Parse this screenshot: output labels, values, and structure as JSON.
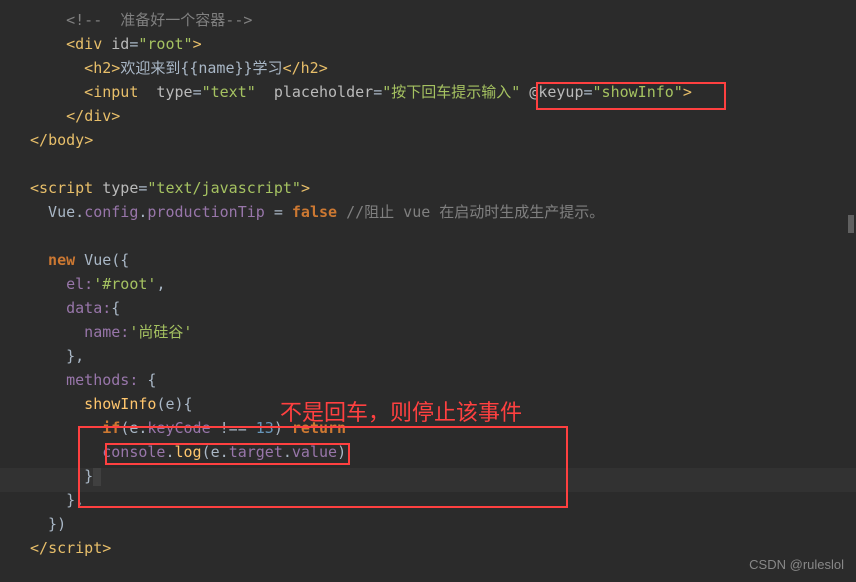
{
  "code": {
    "l1": "    <!--  准备好一个容器-->",
    "l2_p1": "    <",
    "l2_tag": "div",
    "l2_attr": " id",
    "l2_eq": "=",
    "l2_val": "\"root\"",
    "l2_close": ">",
    "l3_p1": "      <",
    "l3_tag": "h2",
    "l3_close1": ">",
    "l3_text": "欢迎来到{{name}}学习",
    "l3_closetag": "</",
    "l3_tag2": "h2",
    "l3_close2": ">",
    "l4_p1": "      <",
    "l4_tag": "input",
    "l4_attr1": "  type",
    "l4_eq1": "=",
    "l4_val1": "\"text\"",
    "l4_attr2": "  placeholder",
    "l4_eq2": "=",
    "l4_val2": "\"按下回车提示输入\"",
    "l4_attr3": " @keyup",
    "l4_eq3": "=",
    "l4_val3": "\"showInfo\"",
    "l4_close": ">",
    "l5_p1": "    </",
    "l5_tag": "div",
    "l5_close": ">",
    "l6_p1": "</",
    "l6_tag": "body",
    "l6_close": ">",
    "l8_p1": "<",
    "l8_tag": "script",
    "l8_attr": " type",
    "l8_eq": "=",
    "l8_val": "\"text/javascript\"",
    "l8_close": ">",
    "l9_vue": "  Vue",
    "l9_dot1": ".",
    "l9_config": "config",
    "l9_dot2": ".",
    "l9_prop": "productionTip",
    "l9_eq": " = ",
    "l9_false": "false",
    "l9_sp": " ",
    "l9_comment": "//阻止 vue 在启动时生成生产提示。",
    "l11_new": "  new",
    "l11_vue": " Vue",
    "l11_paren": "({",
    "l12_el": "    el:",
    "l12_val": "'#root'",
    "l12_comma": ",",
    "l13_data": "    data:",
    "l13_brace": "{",
    "l14_name": "      name:",
    "l14_val": "'尚硅谷'",
    "l15_close": "    },",
    "l16_methods": "    methods:",
    "l16_brace": " {",
    "l17_show": "      showInfo",
    "l17_paren": "(",
    "l17_e": "e",
    "l17_close": "){",
    "l18_if": "        if",
    "l18_paren": "(",
    "l18_e": "e",
    "l18_dot": ".",
    "l18_kc": "keyCode",
    "l18_neq": " !== ",
    "l18_num": "13",
    "l18_close": ") ",
    "l18_return": "return",
    "l19_indent": "        ",
    "l19_console": "console",
    "l19_dot": ".",
    "l19_log": "log",
    "l19_paren": "(",
    "l19_e": "e",
    "l19_dot2": ".",
    "l19_target": "target",
    "l19_dot3": ".",
    "l19_value": "value",
    "l19_close": ")",
    "l20_close": "      }",
    "l21_close": "    },",
    "l22_close": "  })",
    "l23_p1": "</",
    "l23_tag": "script",
    "l23_close": ">"
  },
  "annotation": "不是回车，则停止该事件",
  "watermark": "CSDN @ruleslol"
}
